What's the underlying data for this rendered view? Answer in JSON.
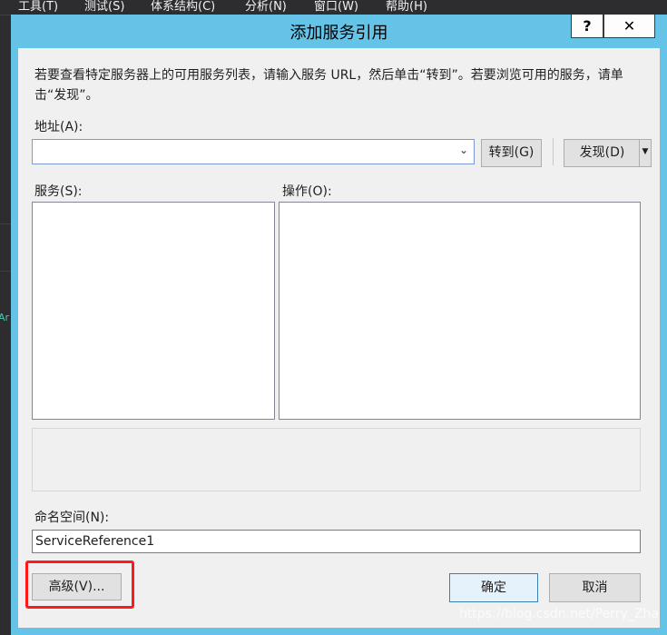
{
  "ide": {
    "menu": [
      "工具(T)",
      "测试(S)",
      "体系结构(C)",
      "分析(N)",
      "窗口(W)",
      "帮助(H)"
    ],
    "side_text": "Ar"
  },
  "dialog": {
    "title": "添加服务引用",
    "help_glyph": "?",
    "close_glyph": "✕",
    "instruction": "若要查看特定服务器上的可用服务列表，请输入服务 URL，然后单击“转到”。若要浏览可用的服务，请单击“发现”。",
    "address_label": "地址(A):",
    "address_value": "",
    "goto_label": "转到(G)",
    "discover_label": "发现(D)",
    "services_label": "服务(S):",
    "operations_label": "操作(O):",
    "namespace_label": "命名空间(N):",
    "namespace_value": "ServiceReference1",
    "advanced_label": "高级(V)...",
    "ok_label": "确定",
    "cancel_label": "取消"
  },
  "watermark": "https://blog.csdn.net/Perry_Zha",
  "colors": {
    "title_bar": "#66c3e8",
    "body": "#f0f0f0",
    "highlight": "#ff1a1a",
    "ide_background": "#2d2d30"
  }
}
